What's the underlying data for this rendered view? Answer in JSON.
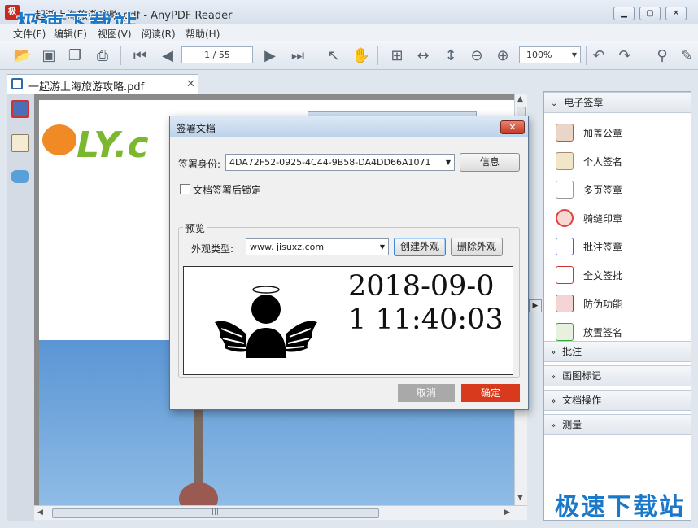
{
  "window": {
    "title": "一起游上海旅游攻略.pdf - AnyPDF Reader",
    "icon_text": "极",
    "watermark": "极速下载站"
  },
  "menu": [
    "文件(F)",
    "编辑(E)",
    "视图(V)",
    "阅读(R)",
    "帮助(H)"
  ],
  "toolbar": {
    "page_indicator": "1 / 55",
    "zoom": "100%"
  },
  "tab": {
    "label": "一起游上海旅游攻略.pdf",
    "close": "✕"
  },
  "document": {
    "logo_text": "LY.c"
  },
  "right_panel": {
    "sections": {
      "signature": "电子签章",
      "annotation": "批注",
      "drawing": "画图标记",
      "doc_ops": "文档操作",
      "measure": "测量"
    },
    "signature_items": [
      "加盖公章",
      "个人签名",
      "多页签章",
      "骑缝印章",
      "批注签章",
      "全文签批",
      "防伪功能",
      "放置签名"
    ]
  },
  "dialog": {
    "title": "签署文档",
    "identity_label": "签署身份:",
    "identity_value": "4DA72F52-0925-4C44-9B58-DA4DD66A1071",
    "info_button": "信息",
    "lock_label": "文档签署后锁定",
    "preview_group": "预览",
    "appearance_label": "外观类型:",
    "appearance_value": "www. jisuxz.com",
    "create_button": "创建外观",
    "delete_button": "删除外观",
    "preview_datetime": "2018-09-01 11:40:03",
    "cancel_button": "取消",
    "ok_button": "确定"
  },
  "colors": {
    "accent": "#d73a1c",
    "watermark": "#1c78c8"
  }
}
